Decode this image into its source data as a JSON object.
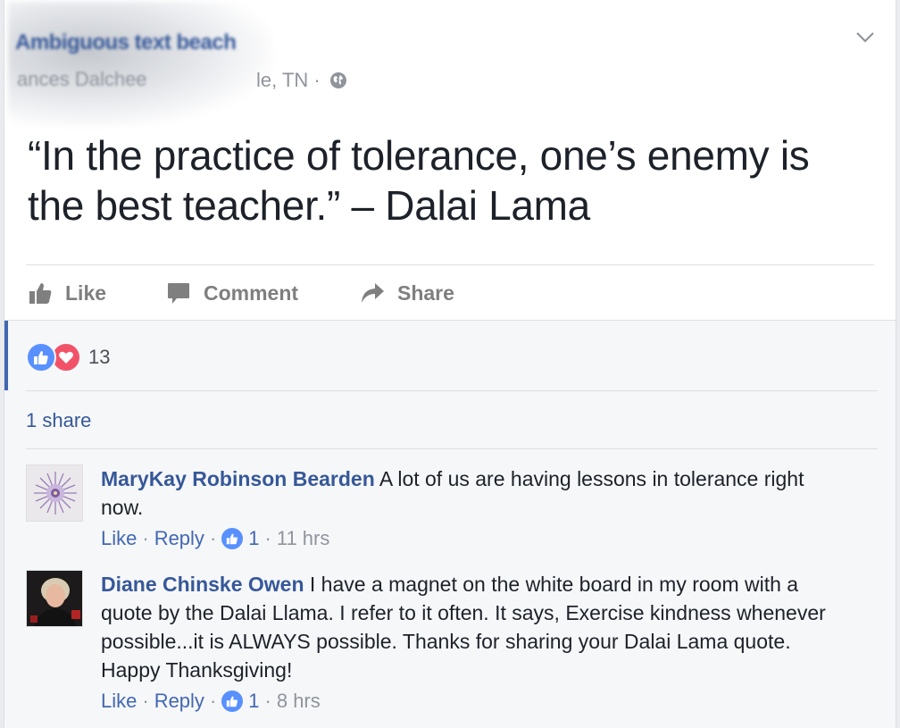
{
  "post": {
    "author_name": "Ambiguous text beach",
    "author_name_tail": "h",
    "author_sub": "ances Dalchee",
    "location": "le, TN ·",
    "text": "“In the practice of tolerance, one’s enemy is the best teacher.” – Dalai Lama"
  },
  "actions": {
    "like": "Like",
    "comment": "Comment",
    "share": "Share"
  },
  "feedback": {
    "reaction_count": "13",
    "shares": "1 share"
  },
  "comments": [
    {
      "name": "MaryKay Robinson Bearden",
      "text": " A lot of us are having lessons in tolerance right now.",
      "like": "Like",
      "reply": "Reply",
      "likes": "1",
      "time": "11 hrs"
    },
    {
      "name": "Diane Chinske Owen",
      "text": " I have a magnet on the white board in my room with a quote by the Dalai Llama. I refer to it often. It says, Exercise kindness whenever possible...it is ALWAYS possible. Thanks for sharing your Dalai Lama quote. Happy Thanksgiving!",
      "like": "Like",
      "reply": "Reply",
      "likes": "1",
      "time": "8 hrs"
    }
  ],
  "colors": {
    "link": "#365899",
    "like_blue": "#5890ff",
    "love_red": "#f25268"
  }
}
